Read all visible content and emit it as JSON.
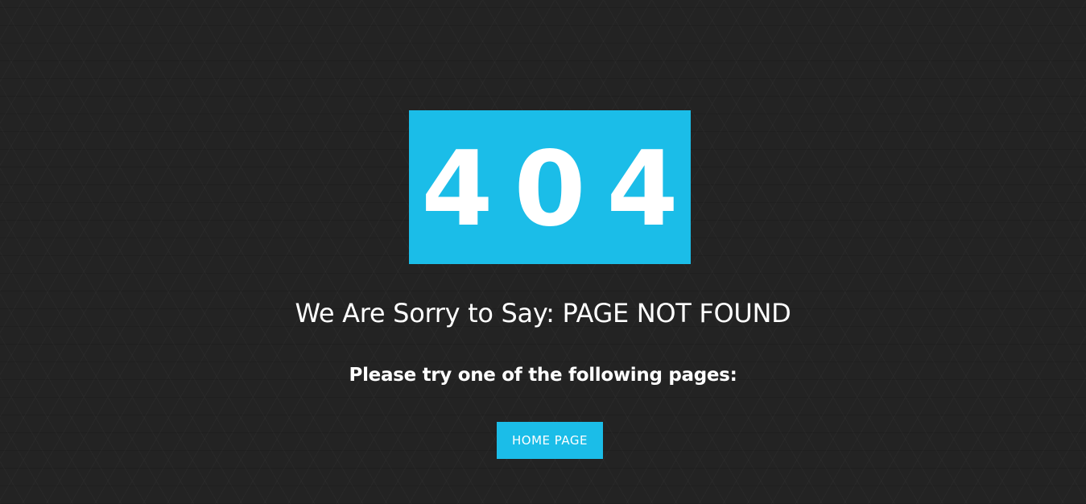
{
  "error": {
    "code": "404"
  },
  "message": {
    "headline": "We Are Sorry to Say: PAGE NOT FOUND",
    "subline": "Please try one of the following pages:"
  },
  "links": {
    "home_label": "HOME PAGE"
  },
  "colors": {
    "background": "#232323",
    "accent": "#1bbde8",
    "text": "#ffffff"
  }
}
